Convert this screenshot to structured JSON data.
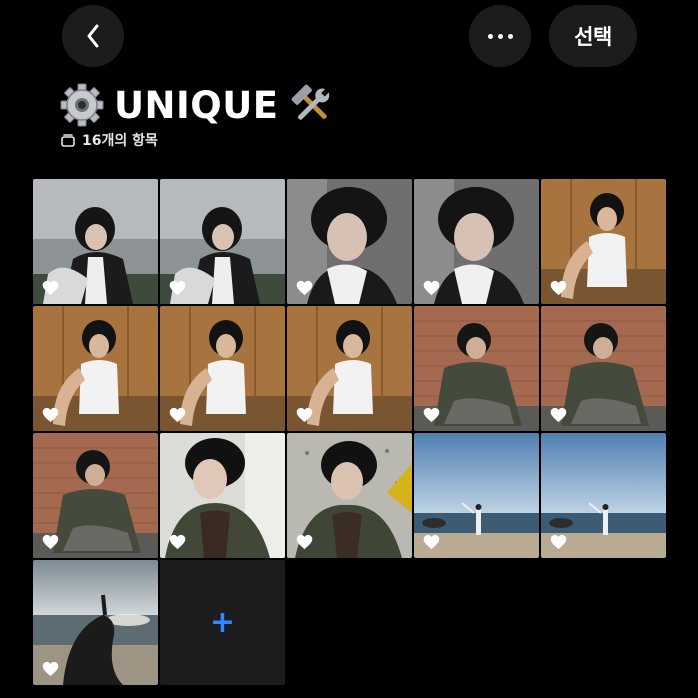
{
  "topbar": {
    "back_icon": "chevron-left-icon",
    "more_icon": "ellipsis-icon",
    "select_label": "선택"
  },
  "album": {
    "title": "UNIQUE",
    "title_prefix_icon": "gear-icon",
    "title_suffix_icon": "hammer-wrench-icon",
    "count_icon": "stack-icon",
    "item_count": "16개의 항목"
  },
  "photos": [
    {
      "scene": "gray-room-lean",
      "favorite": true
    },
    {
      "scene": "gray-room-lean",
      "favorite": true
    },
    {
      "scene": "curly-closeup",
      "favorite": true
    },
    {
      "scene": "curly-closeup",
      "favorite": true
    },
    {
      "scene": "wood-selfie",
      "favorite": true
    },
    {
      "scene": "wood-selfie",
      "favorite": true
    },
    {
      "scene": "wood-selfie",
      "favorite": true
    },
    {
      "scene": "wood-selfie",
      "favorite": true
    },
    {
      "scene": "brick-sitting",
      "favorite": true
    },
    {
      "scene": "brick-sitting",
      "favorite": true
    },
    {
      "scene": "brick-sitting",
      "favorite": true
    },
    {
      "scene": "jacket-closeup",
      "favorite": true
    },
    {
      "scene": "jacket-closeup-concrete",
      "favorite": true
    },
    {
      "scene": "beach-far",
      "favorite": true
    },
    {
      "scene": "beach-far",
      "favorite": true
    },
    {
      "scene": "beach-silhouette",
      "favorite": true
    }
  ],
  "add_tile": {
    "icon": "plus-icon",
    "color": "#2f88ff"
  },
  "colors": {
    "background": "#000000",
    "button": "#1c1c1e",
    "accent": "#2f88ff"
  }
}
